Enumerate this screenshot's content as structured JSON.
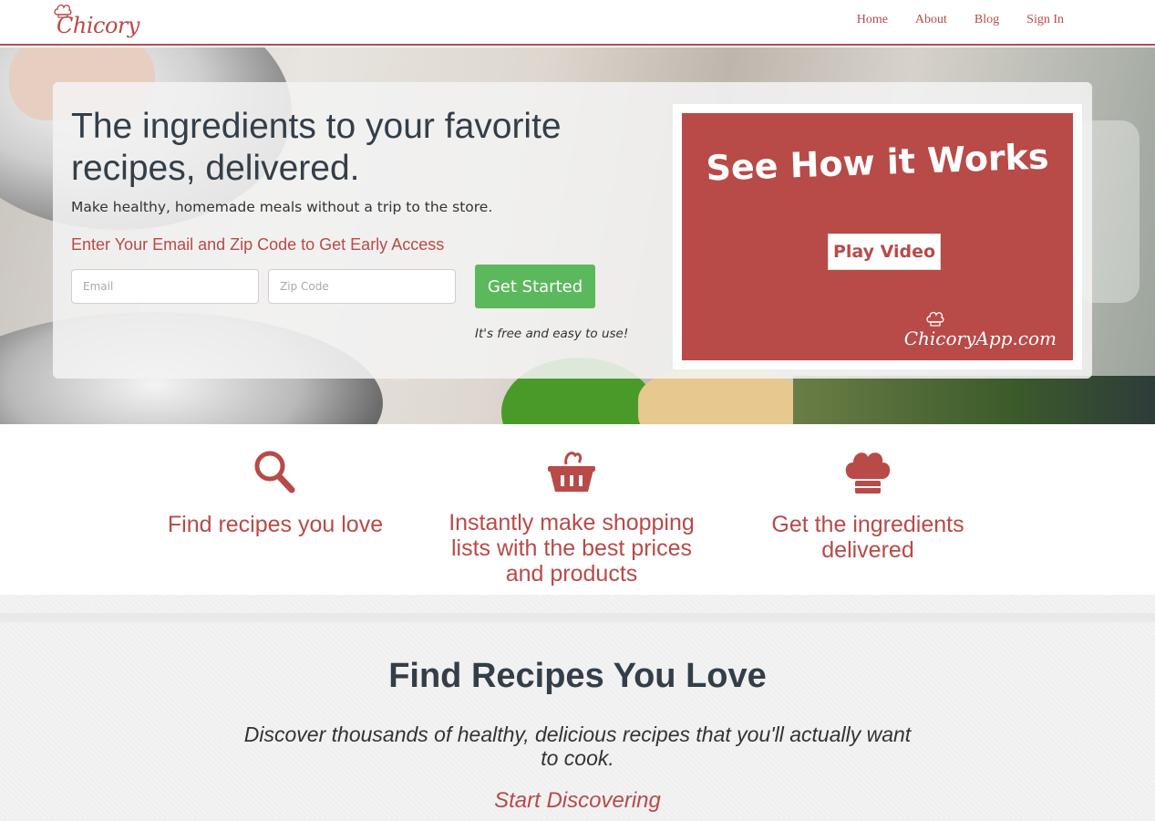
{
  "nav": {
    "logo": "Chicory",
    "links": [
      "Home",
      "About",
      "Blog",
      "Sign In"
    ]
  },
  "hero": {
    "title": "The ingredients to your favorite recipes, delivered.",
    "subtitle": "Make healthy, homemade meals without a trip to the store.",
    "cta_text": "Enter Your Email and Zip Code to Get Early Access",
    "email_placeholder": "Email",
    "zip_placeholder": "Zip Code",
    "button_label": "Get Started",
    "free_note": "It's free and easy to use!",
    "video": {
      "title": "See How it Works",
      "play_label": "Play Video",
      "brand": "ChicoryApp.com"
    }
  },
  "features": [
    {
      "icon": "search-icon",
      "label": "Find recipes you love"
    },
    {
      "icon": "basket-icon",
      "label": "Instantly make shopping lists with the best prices and products"
    },
    {
      "icon": "chef-hat-icon",
      "label": "Get the ingredients delivered"
    }
  ],
  "section2": {
    "title": "Find Recipes You Love",
    "description": "Discover thousands of healthy, delicious recipes that you'll actually want to cook.",
    "link": "Start Discovering"
  },
  "colors": {
    "brand": "#b84a47",
    "button_green": "#5cb85c",
    "heading": "#333e48"
  }
}
